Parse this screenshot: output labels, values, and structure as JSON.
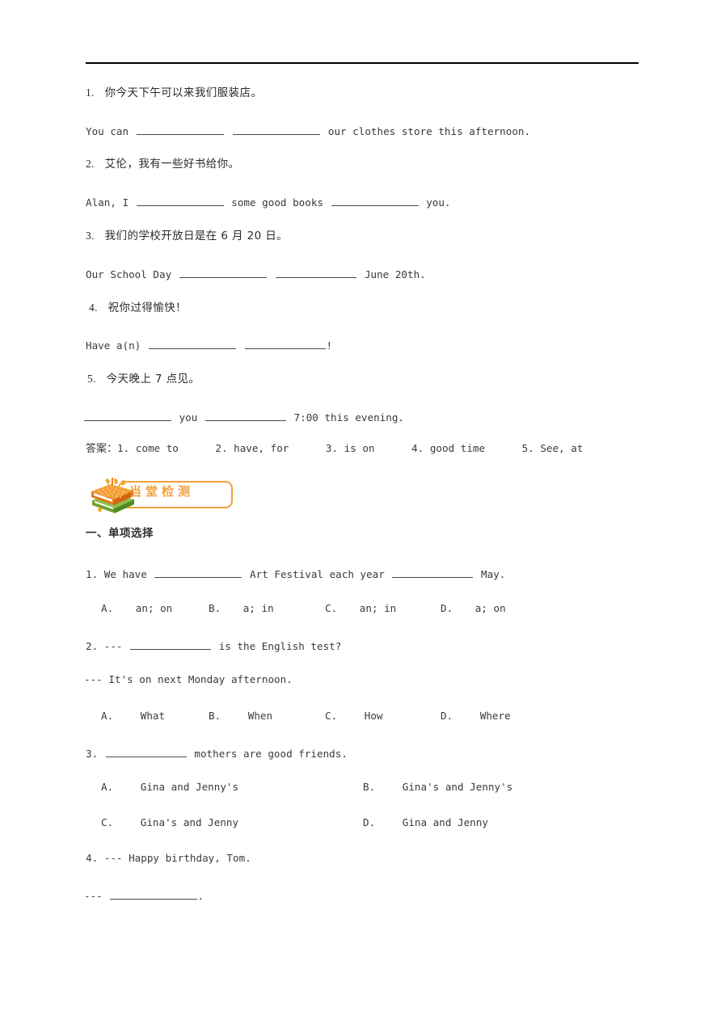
{
  "document": {
    "type": "worksheet",
    "accent_color": "#f0a13c",
    "text_color": "#3a3a3a",
    "rule_color": "#000000"
  },
  "translation_section": {
    "items": [
      {
        "num": "1.",
        "chinese": "你今天下午可以来我们服装店。",
        "english_pre": "You can",
        "english_mid": "",
        "english_post": "our clothes store this afternoon.",
        "blanks": 2
      },
      {
        "num": "2.",
        "chinese": "艾伦，我有一些好书给你。",
        "english_pre": "Alan, I",
        "english_mid": "some good books",
        "english_post": "you.",
        "blanks": 2
      },
      {
        "num": "3.",
        "chinese": "我们的学校开放日是在 6 月 20 日。",
        "english_pre": "Our School Day",
        "english_mid": "",
        "english_post": "June 20th.",
        "blanks": 2
      },
      {
        "num": "4.",
        "chinese": "祝你过得愉快！",
        "english_pre": "Have a(n)",
        "english_mid": "",
        "english_post": "!",
        "blanks": 2
      },
      {
        "num": "5.",
        "chinese": "今天晚上 7 点见。",
        "english_pre": "",
        "english_mid": "you",
        "english_post": "7:00 this evening.",
        "blanks": 2
      }
    ],
    "answer_label": "答案：",
    "answers": [
      {
        "num": "1.",
        "text": "come to"
      },
      {
        "num": "2.",
        "text": "have, for"
      },
      {
        "num": "3.",
        "text": "is on"
      },
      {
        "num": "4.",
        "text": "good time"
      },
      {
        "num": "5.",
        "text": "See, at"
      }
    ],
    "answers_line": "答案：1. come to      2. have, for      3. is on      4. good time      5. See, at"
  },
  "banner": {
    "label": "当堂检测",
    "icon": "stacked-books-icon",
    "color": "#f0a13c"
  },
  "exercise_section": {
    "heading": "一、单项选择",
    "questions": [
      {
        "num": "1.",
        "stem_pre": "We have",
        "stem_mid": "Art Festival each year",
        "stem_post": "May.",
        "dialog": [],
        "options": [
          {
            "label": "A.",
            "text": "an; on"
          },
          {
            "label": "B.",
            "text": "a; in"
          },
          {
            "label": "C.",
            "text": "an; in"
          },
          {
            "label": "D.",
            "text": "a; on"
          }
        ],
        "option_layout": "four-across"
      },
      {
        "num": "2.",
        "stem_pre": "---",
        "stem_mid": "",
        "stem_post": "is the English test?",
        "dialog": [
          "--- It's on next Monday afternoon."
        ],
        "options": [
          {
            "label": "A.",
            "text": "What"
          },
          {
            "label": "B.",
            "text": "When"
          },
          {
            "label": "C.",
            "text": "How"
          },
          {
            "label": "D.",
            "text": "Where"
          }
        ],
        "option_layout": "four-across"
      },
      {
        "num": "3.",
        "stem_pre": "",
        "stem_mid": "",
        "stem_post": "mothers are good friends.",
        "dialog": [],
        "options": [
          {
            "label": "A.",
            "text": "Gina and Jenny's"
          },
          {
            "label": "B.",
            "text": "Gina's and Jenny's"
          },
          {
            "label": "C.",
            "text": "Gina's and Jenny"
          },
          {
            "label": "D.",
            "text": "Gina and Jenny"
          }
        ],
        "option_layout": "two-by-two"
      },
      {
        "num": "4.",
        "stem_pre": "--- Happy birthday, Tom.",
        "stem_mid": "",
        "stem_post": "",
        "dialog": [
          "--- ________________."
        ],
        "answer_prefix": "---",
        "answer_suffix": ".",
        "options": [],
        "option_layout": "none"
      }
    ]
  }
}
